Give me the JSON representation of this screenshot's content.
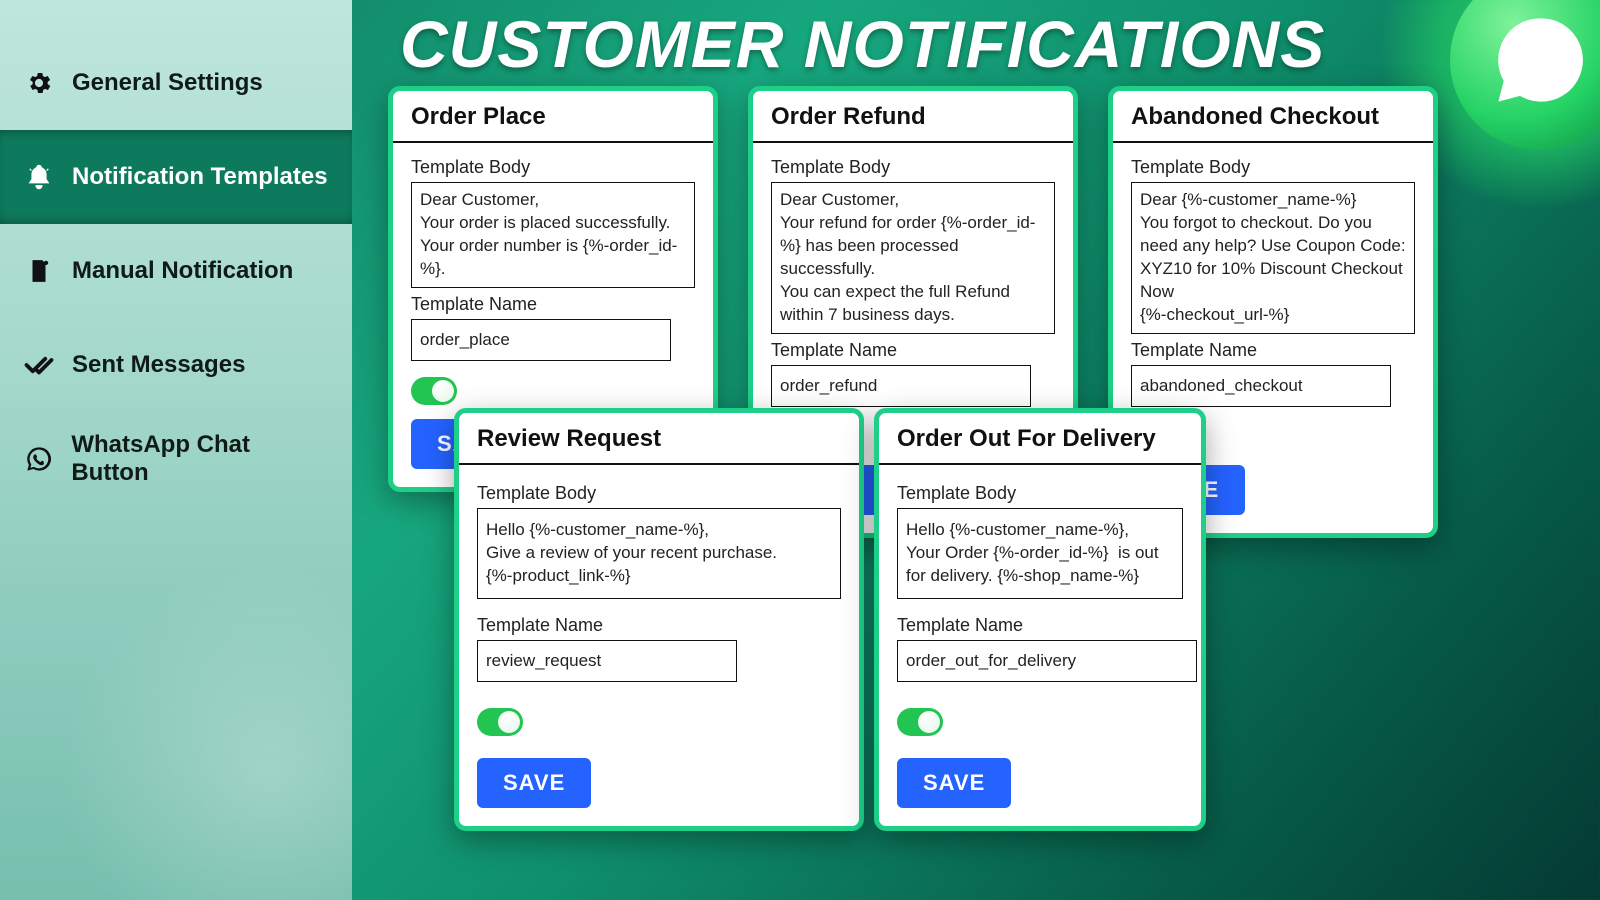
{
  "page": {
    "title": "CUSTOMER NOTIFICATIONS"
  },
  "sidebar": {
    "items": [
      {
        "label": "General Settings",
        "icon": "gear-icon"
      },
      {
        "label": "Notification Templates",
        "icon": "bell-icon",
        "active": true
      },
      {
        "label": "Manual Notification",
        "icon": "document-icon"
      },
      {
        "label": "Sent Messages",
        "icon": "double-check-icon"
      },
      {
        "label": "WhatsApp Chat Button",
        "icon": "whatsapp-icon"
      }
    ]
  },
  "labels": {
    "template_body": "Template Body",
    "template_name": "Template Name",
    "save": "SAVE"
  },
  "cards": {
    "order_place": {
      "title": "Order Place",
      "body": "Dear Customer,\nYour order is placed successfully.\nYour order number is {%-order_id-%}.",
      "name": "order_place",
      "enabled": true
    },
    "order_refund": {
      "title": "Order Refund",
      "body": "Dear Customer,\nYour refund for order {%-order_id-%} has been processed successfully.\nYou can expect the full Refund within 7 business days.",
      "name": "order_refund",
      "enabled": true
    },
    "abandoned_checkout": {
      "title": "Abandoned Checkout",
      "body": "Dear {%-customer_name-%}\nYou forgot to checkout. Do you need any help? Use Coupon Code: XYZ10 for 10% Discount Checkout Now\n{%-checkout_url-%}",
      "name": "abandoned_checkout",
      "enabled": true
    },
    "review_request": {
      "title": "Review Request",
      "body": "Hello {%-customer_name-%},\nGive a review of your recent purchase.\n{%-product_link-%}",
      "name": "review_request",
      "enabled": true
    },
    "order_out": {
      "title": "Order Out For Delivery",
      "body": "Hello {%-customer_name-%},\nYour Order {%-order_id-%}  is out for delivery. {%-shop_name-%}",
      "name": "order_out_for_delivery",
      "enabled": true
    }
  }
}
